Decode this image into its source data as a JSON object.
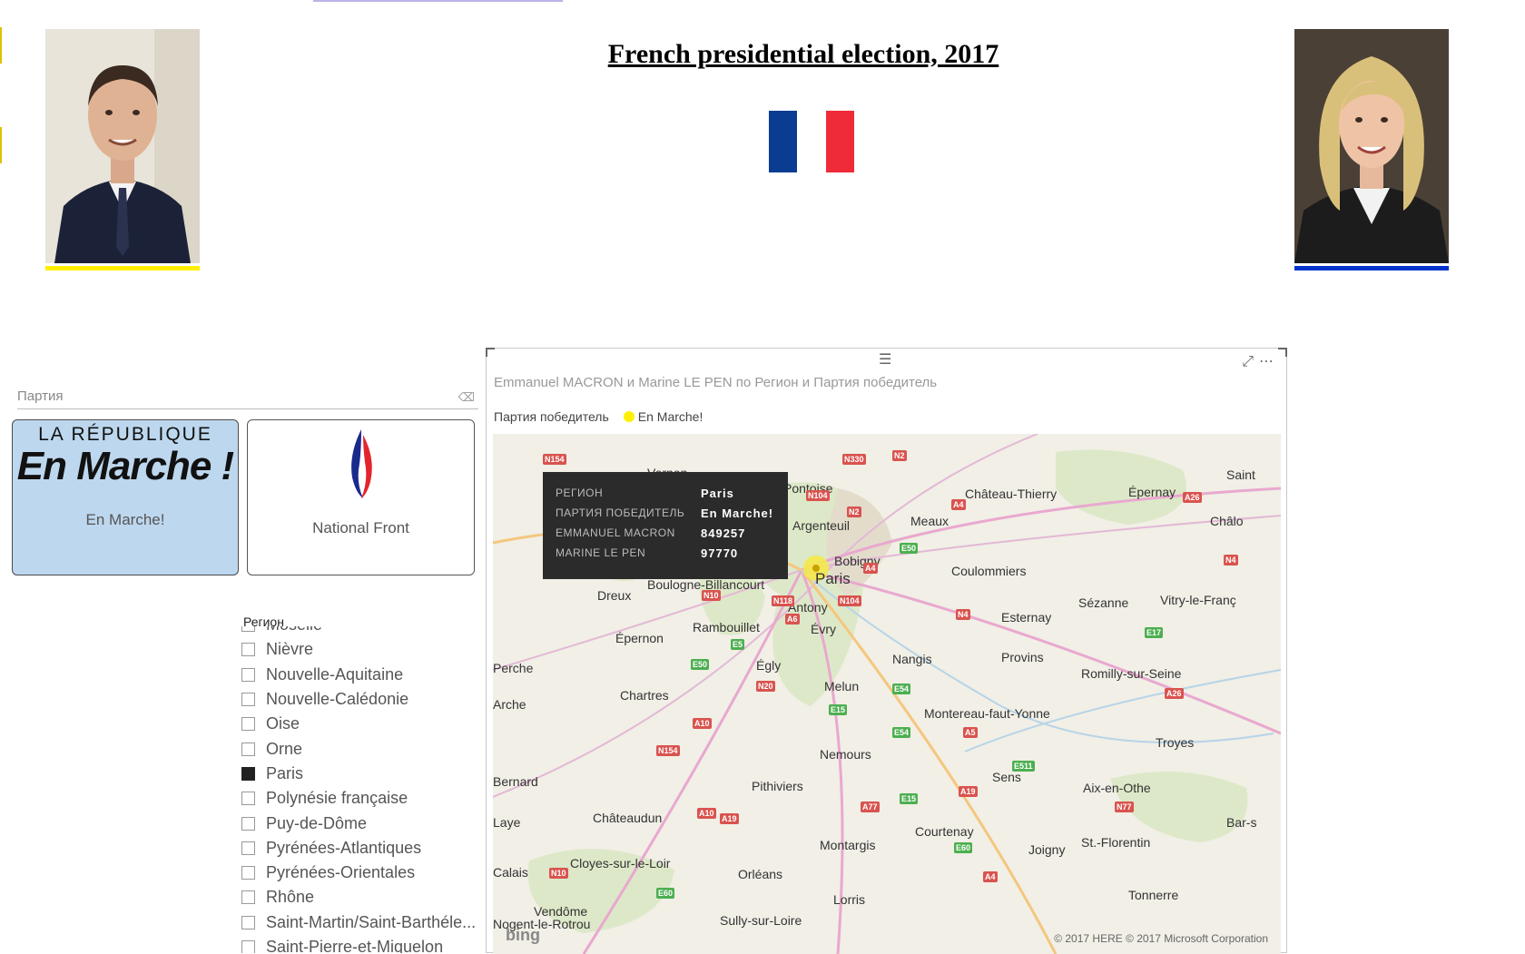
{
  "header": {
    "title": "French presidential election, 2017"
  },
  "colors": {
    "flag_blue": "#0a3d91",
    "flag_white": "#ffffff",
    "flag_red": "#ef2b3a",
    "macron_accent": "#ffef00",
    "lepen_accent": "#0033cc",
    "selected_card": "#bdd7ee",
    "legend_en_marche": "#ffef00"
  },
  "party_slicer": {
    "label": "Партия",
    "cards": [
      {
        "logo_top": "LA RÉPUBLIQUE",
        "logo_main": "En Marche !",
        "name": "En Marche!",
        "selected": true
      },
      {
        "name": "National Front",
        "selected": false
      }
    ]
  },
  "region_slicer": {
    "label": "Регион",
    "items": [
      {
        "label": "Moselle",
        "checked": false
      },
      {
        "label": "Nièvre",
        "checked": false
      },
      {
        "label": "Nouvelle-Aquitaine",
        "checked": false
      },
      {
        "label": "Nouvelle-Calédonie",
        "checked": false
      },
      {
        "label": "Oise",
        "checked": false
      },
      {
        "label": "Orne",
        "checked": false
      },
      {
        "label": "Paris",
        "checked": true
      },
      {
        "label": "Polynésie française",
        "checked": false
      },
      {
        "label": "Puy-de-Dôme",
        "checked": false
      },
      {
        "label": "Pyrénées-Atlantiques",
        "checked": false
      },
      {
        "label": "Pyrénées-Orientales",
        "checked": false
      },
      {
        "label": "Rhône",
        "checked": false
      },
      {
        "label": "Saint-Martin/Saint-Barthéle...",
        "checked": false
      },
      {
        "label": "Saint-Pierre-et-Miquelon",
        "checked": false
      }
    ]
  },
  "map_visual": {
    "title": "Emmanuel MACRON  и Marine LE PEN по Регион и Партия победитель",
    "legend_title": "Партия победитель",
    "legend_item": "En Marche!",
    "tooltip": [
      {
        "key": "РЕГИОН",
        "value": "Paris"
      },
      {
        "key": "ПАРТИЯ ПОБЕДИТЕЛЬ",
        "value": "En Marche!"
      },
      {
        "key": "EMMANUEL MACRON",
        "value": "849257"
      },
      {
        "key": "MARINE LE PEN",
        "value": "97770"
      }
    ],
    "bing_label": "bing",
    "copyright": "© 2017 HERE  © 2017 Microsoft Corporation",
    "places": [
      "Vernon",
      "Pontoise",
      "Argenteuil",
      "Bobigny",
      "Paris",
      "Boulogne-Billancourt",
      "Antony",
      "Évry",
      "Dreux",
      "Rambouillet",
      "Épernon",
      "Chartres",
      "Égly",
      "Melun",
      "Nangis",
      "Provins",
      "Coulommiers",
      "Meaux",
      "Château-Thierry",
      "Épernay",
      "Esternay",
      "Sézanne",
      "Vitry-le-Franç",
      "Romilly-sur-Seine",
      "Montereau-faut-Yonne",
      "Nemours",
      "Sens",
      "Troyes",
      "Aix-en-Othe",
      "Pithiviers",
      "Châteaudun",
      "Courtenay",
      "Montargis",
      "Joigny",
      "St.-Florentin",
      "Orléans",
      "Cloyes-sur-le-Loir",
      "Tonnerre",
      "Lorris",
      "Vendôme",
      "Sully-sur-Loire",
      "Nogent-le-Rotrou",
      "Bernard",
      "Bar-s",
      "Saint",
      "Châlo",
      "Perche",
      "Calais",
      "Laye",
      "Arche"
    ],
    "roads": [
      "N154",
      "N330",
      "N2",
      "N104",
      "N2",
      "A4",
      "E50",
      "A4",
      "N10",
      "N118",
      "A6",
      "N104",
      "N4",
      "E17",
      "E5",
      "E50",
      "N20",
      "E54",
      "N154",
      "A10",
      "E15",
      "E54",
      "A5",
      "E511",
      "A26",
      "A19",
      "N77",
      "A77",
      "E15",
      "E60",
      "A19",
      "A10",
      "N10",
      "E60",
      "A4",
      "A26",
      "N4"
    ]
  }
}
